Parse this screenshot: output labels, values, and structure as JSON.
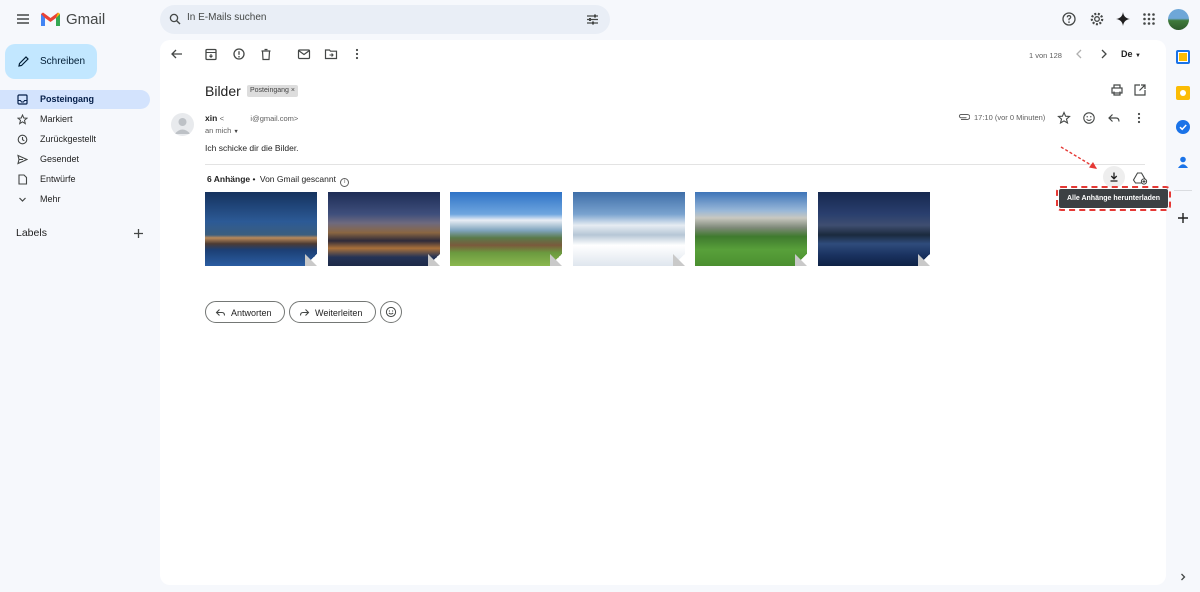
{
  "app": {
    "name": "Gmail"
  },
  "search": {
    "placeholder": "In E-Mails suchen"
  },
  "sidebar": {
    "compose_label": "Schreiben",
    "items": [
      {
        "label": "Posteingang",
        "icon": "inbox-icon",
        "active": true
      },
      {
        "label": "Markiert",
        "icon": "star-icon"
      },
      {
        "label": "Zurückgestellt",
        "icon": "clock-icon"
      },
      {
        "label": "Gesendet",
        "icon": "send-icon"
      },
      {
        "label": "Entwürfe",
        "icon": "file-icon"
      },
      {
        "label": "Mehr",
        "icon": "chevron-down-icon"
      }
    ],
    "labels_title": "Labels"
  },
  "toolbar": {
    "pagination": "1 von 128",
    "lang": "De"
  },
  "message": {
    "subject": "Bilder",
    "label_badge": "Posteingang",
    "sender_name": "xin",
    "sender_email_prefix": "<",
    "sender_email_suffix": "i@gmail.com>",
    "recipient": "an mich",
    "time": "17:10 (vor 0 Minuten)",
    "body": "Ich schicke dir die Bilder.",
    "attachments_count": "6 Anhänge",
    "scan_text": "Von Gmail gescannt",
    "download_all_tooltip": "Alle Anhänge herunterladen"
  },
  "actions": {
    "reply": "Antworten",
    "forward": "Weiterleiten"
  },
  "colors": {
    "accent": "#0b57d0",
    "compose_bg": "#c2e7ff",
    "active_nav": "#d3e3fd",
    "annotation": "#e53935"
  }
}
